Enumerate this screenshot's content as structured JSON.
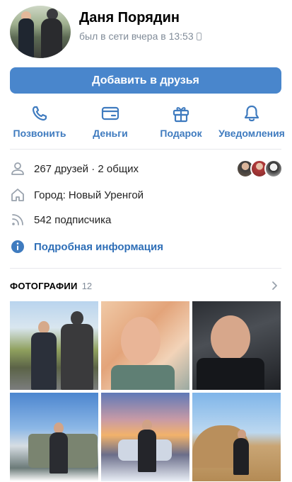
{
  "profile": {
    "name": "Даня Порядин",
    "status": "был в сети вчера в 13:53"
  },
  "add_friend_label": "Добавить в друзья",
  "actions": [
    {
      "label": "Позвонить",
      "icon": "phone-icon"
    },
    {
      "label": "Деньги",
      "icon": "money-icon"
    },
    {
      "label": "Подарок",
      "icon": "gift-icon"
    },
    {
      "label": "Уведомления",
      "icon": "bell-icon"
    }
  ],
  "info": {
    "friends": "267 друзей · 2 общих",
    "city": "Город: Новый Уренгой",
    "followers": "542 подписчика",
    "details": "Подробная информация"
  },
  "photos": {
    "title": "ФОТОГРАФИИ",
    "count": "12"
  },
  "colors": {
    "accent": "#4986cc",
    "link": "#2f6fb7",
    "secondary_text": "#818c99"
  }
}
